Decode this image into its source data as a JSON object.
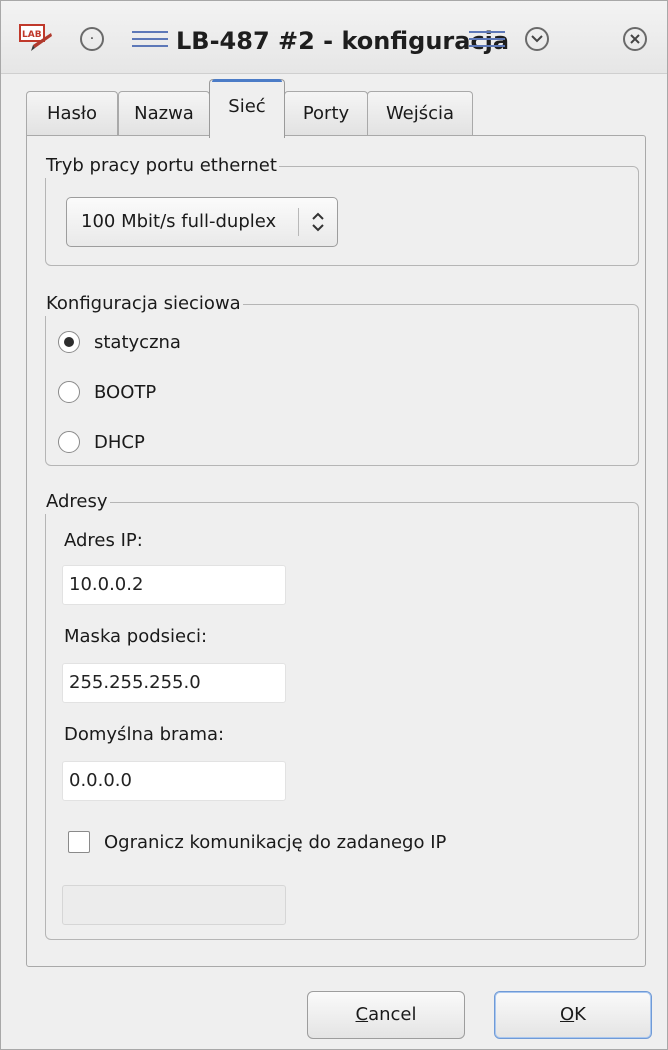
{
  "window": {
    "title": "LB-487 #2 - konfiguracja",
    "icons": [
      "app-logo-icon",
      "menu-circle-icon",
      "minimize-icon",
      "close-icon"
    ]
  },
  "tabs": [
    {
      "label": "Hasło",
      "active": false
    },
    {
      "label": "Nazwa",
      "active": false
    },
    {
      "label": "Sieć",
      "active": true
    },
    {
      "label": "Porty",
      "active": false
    },
    {
      "label": "Wejścia",
      "active": false
    }
  ],
  "ethernet_group": {
    "legend": "Tryb pracy portu ethernet",
    "selected": "100 Mbit/s full-duplex"
  },
  "network_group": {
    "legend": "Konfiguracja sieciowa",
    "options": [
      {
        "label": "statyczna",
        "checked": true
      },
      {
        "label": "BOOTP",
        "checked": false
      },
      {
        "label": "DHCP",
        "checked": false
      }
    ]
  },
  "address_group": {
    "legend": "Adresy",
    "ip_label": "Adres IP:",
    "ip_value": "10.0.0.2",
    "mask_label": "Maska podsieci:",
    "mask_value": "255.255.255.0",
    "gateway_label": "Domyślna brama:",
    "gateway_value": "0.0.0.0",
    "restrict_label": "Ogranicz komunikację do zadanego IP",
    "restrict_checked": false,
    "restrict_ip_value": ""
  },
  "buttons": {
    "cancel_label_rest": "ancel",
    "cancel_mnemonic": "C",
    "ok_mnemonic": "O",
    "ok_label_rest": "K"
  },
  "colors": {
    "accent": "#4c7cc7",
    "title_lines": "#5d78b8",
    "logo_red": "#c0392b"
  }
}
